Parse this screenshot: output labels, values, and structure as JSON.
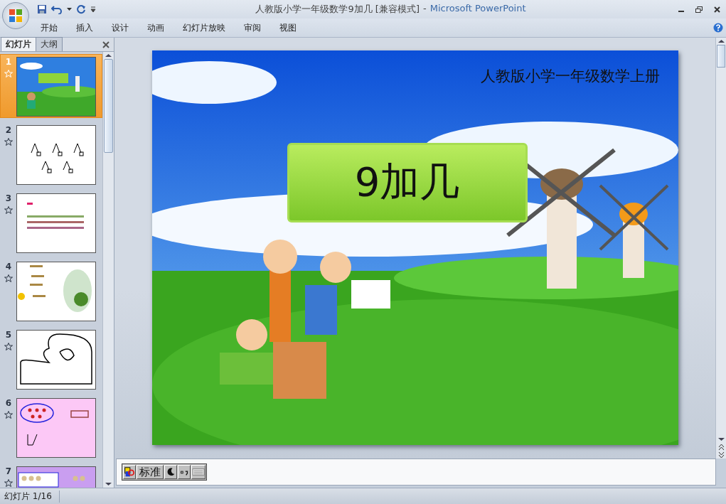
{
  "window": {
    "document_title": "人教版小学一年级数学9加几 [兼容模式]",
    "separator": "-",
    "app_name": "Microsoft PowerPoint"
  },
  "ribbon_tabs": [
    {
      "label": "开始",
      "selected": false
    },
    {
      "label": "插入",
      "selected": false
    },
    {
      "label": "设计",
      "selected": false
    },
    {
      "label": "动画",
      "selected": false
    },
    {
      "label": "幻灯片放映",
      "selected": false
    },
    {
      "label": "审阅",
      "selected": false
    },
    {
      "label": "视图",
      "selected": false
    }
  ],
  "panel_tabs": [
    {
      "label": "幻灯片",
      "selected": true
    },
    {
      "label": "大纲",
      "selected": false
    }
  ],
  "slides": [
    {
      "number": "1",
      "kind": "title",
      "selected": true
    },
    {
      "number": "2",
      "kind": "trees",
      "selected": false
    },
    {
      "number": "3",
      "kind": "sums",
      "selected": false
    },
    {
      "number": "4",
      "kind": "plant",
      "selected": false
    },
    {
      "number": "5",
      "kind": "outline",
      "selected": false
    },
    {
      "number": "6",
      "kind": "pink",
      "selected": false
    },
    {
      "number": "7",
      "kind": "purple",
      "selected": false
    }
  ],
  "slide": {
    "subtitle": "人教版小学一年级数学上册",
    "title": "9加几"
  },
  "ime_toolbar": {
    "mode": "标准"
  },
  "status_bar": {
    "text": "幻灯片 1/16"
  }
}
